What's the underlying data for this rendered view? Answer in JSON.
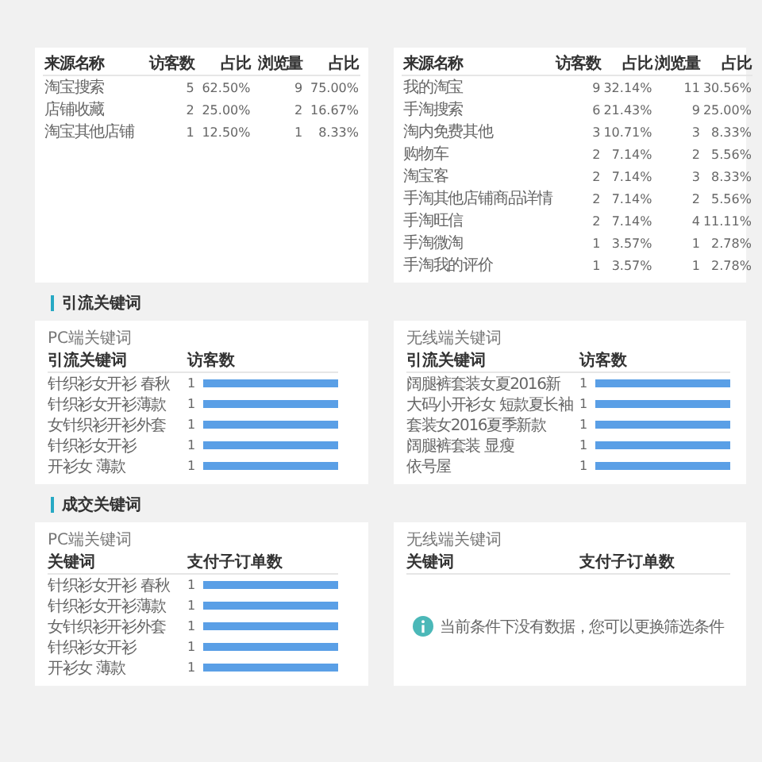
{
  "source_tables": [
    {
      "columns": [
        "来源名称",
        "访客数",
        "占比",
        "浏览量",
        "占比"
      ],
      "rows": [
        [
          "淘宝搜索",
          "5",
          "62.50%",
          "9",
          "75.00%"
        ],
        [
          "店铺收藏",
          "2",
          "25.00%",
          "2",
          "16.67%"
        ],
        [
          "淘宝其他店铺",
          "1",
          "12.50%",
          "1",
          "8.33%"
        ]
      ]
    },
    {
      "columns": [
        "来源名称",
        "访客数",
        "占比",
        "浏览量",
        "占比"
      ],
      "rows": [
        [
          "我的淘宝",
          "9",
          "32.14%",
          "11",
          "30.56%"
        ],
        [
          "手淘搜索",
          "6",
          "21.43%",
          "9",
          "25.00%"
        ],
        [
          "淘内免费其他",
          "3",
          "10.71%",
          "3",
          "8.33%"
        ],
        [
          "购物车",
          "2",
          "7.14%",
          "2",
          "5.56%"
        ],
        [
          "淘宝客",
          "2",
          "7.14%",
          "3",
          "8.33%"
        ],
        [
          "手淘其他店铺商品详情",
          "2",
          "7.14%",
          "2",
          "5.56%"
        ],
        [
          "手淘旺信",
          "2",
          "7.14%",
          "4",
          "11.11%"
        ],
        [
          "手淘微淘",
          "1",
          "3.57%",
          "1",
          "2.78%"
        ],
        [
          "手淘我的评价",
          "1",
          "3.57%",
          "1",
          "2.78%"
        ]
      ]
    }
  ],
  "sections": [
    {
      "title": "引流关键词",
      "panels": [
        {
          "label": "PC端关键词",
          "columns": [
            "引流关键词",
            "访客数"
          ],
          "rows": [
            {
              "keyword": "针织衫女开衫 春秋",
              "value": "1"
            },
            {
              "keyword": "针织衫女开衫薄款",
              "value": "1"
            },
            {
              "keyword": "女针织衫开衫外套",
              "value": "1"
            },
            {
              "keyword": "针织衫女开衫",
              "value": "1"
            },
            {
              "keyword": "开衫女 薄款",
              "value": "1"
            }
          ]
        },
        {
          "label": "无线端关键词",
          "columns": [
            "引流关键词",
            "访客数"
          ],
          "rows": [
            {
              "keyword": "阔腿裤套装女夏2016新",
              "value": "1"
            },
            {
              "keyword": "大码小开衫女 短款夏长袖",
              "value": "1"
            },
            {
              "keyword": "套装女2016夏季新款",
              "value": "1"
            },
            {
              "keyword": "阔腿裤套装 显瘦",
              "value": "1"
            },
            {
              "keyword": "依号屋",
              "value": "1"
            }
          ]
        }
      ]
    },
    {
      "title": "成交关键词",
      "panels": [
        {
          "label": "PC端关键词",
          "columns": [
            "关键词",
            "支付子订单数"
          ],
          "rows": [
            {
              "keyword": "针织衫女开衫 春秋",
              "value": "1"
            },
            {
              "keyword": "针织衫女开衫薄款",
              "value": "1"
            },
            {
              "keyword": "女针织衫开衫外套",
              "value": "1"
            },
            {
              "keyword": "针织衫女开衫",
              "value": "1"
            },
            {
              "keyword": "开衫女 薄款",
              "value": "1"
            }
          ]
        },
        {
          "label": "无线端关键词",
          "columns": [
            "关键词",
            "支付子订单数"
          ],
          "empty_message": "当前条件下没有数据，您可以更换筛选条件"
        }
      ]
    }
  ]
}
